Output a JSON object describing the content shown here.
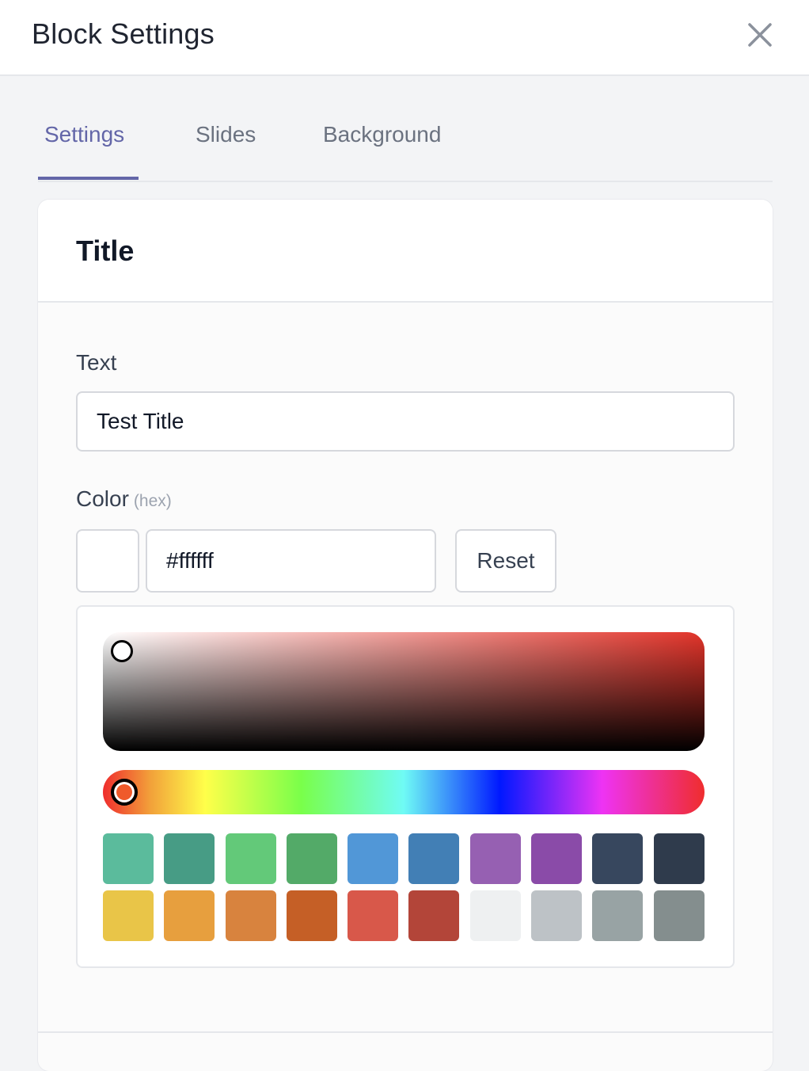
{
  "header": {
    "title": "Block Settings"
  },
  "tabs": [
    {
      "label": "Settings",
      "active": true
    },
    {
      "label": "Slides",
      "active": false
    },
    {
      "label": "Background",
      "active": false
    }
  ],
  "section": {
    "title": "Title"
  },
  "text_field": {
    "label": "Text",
    "value": "Test Title"
  },
  "color_field": {
    "label": "Color",
    "hint": "(hex)",
    "value": "#ffffff",
    "reset_label": "Reset"
  },
  "picker": {
    "hue_color": "#e2342a",
    "selected_hue_marker_color": "#ef5a2b",
    "swatches": [
      "#5bbb9c",
      "#479c85",
      "#63c979",
      "#53aa68",
      "#5197d7",
      "#427fb5",
      "#9660b2",
      "#8a4ba8",
      "#37475e",
      "#2f3b4c",
      "#e9c548",
      "#e79f3e",
      "#d8833e",
      "#c55f26",
      "#d8584a",
      "#b34539",
      "#eef0f1",
      "#bdc2c6",
      "#98a3a4",
      "#848e8e"
    ]
  },
  "colors": {
    "accent": "#6366a8",
    "tab_inactive": "#6b7280",
    "border": "#d6d8dd"
  }
}
